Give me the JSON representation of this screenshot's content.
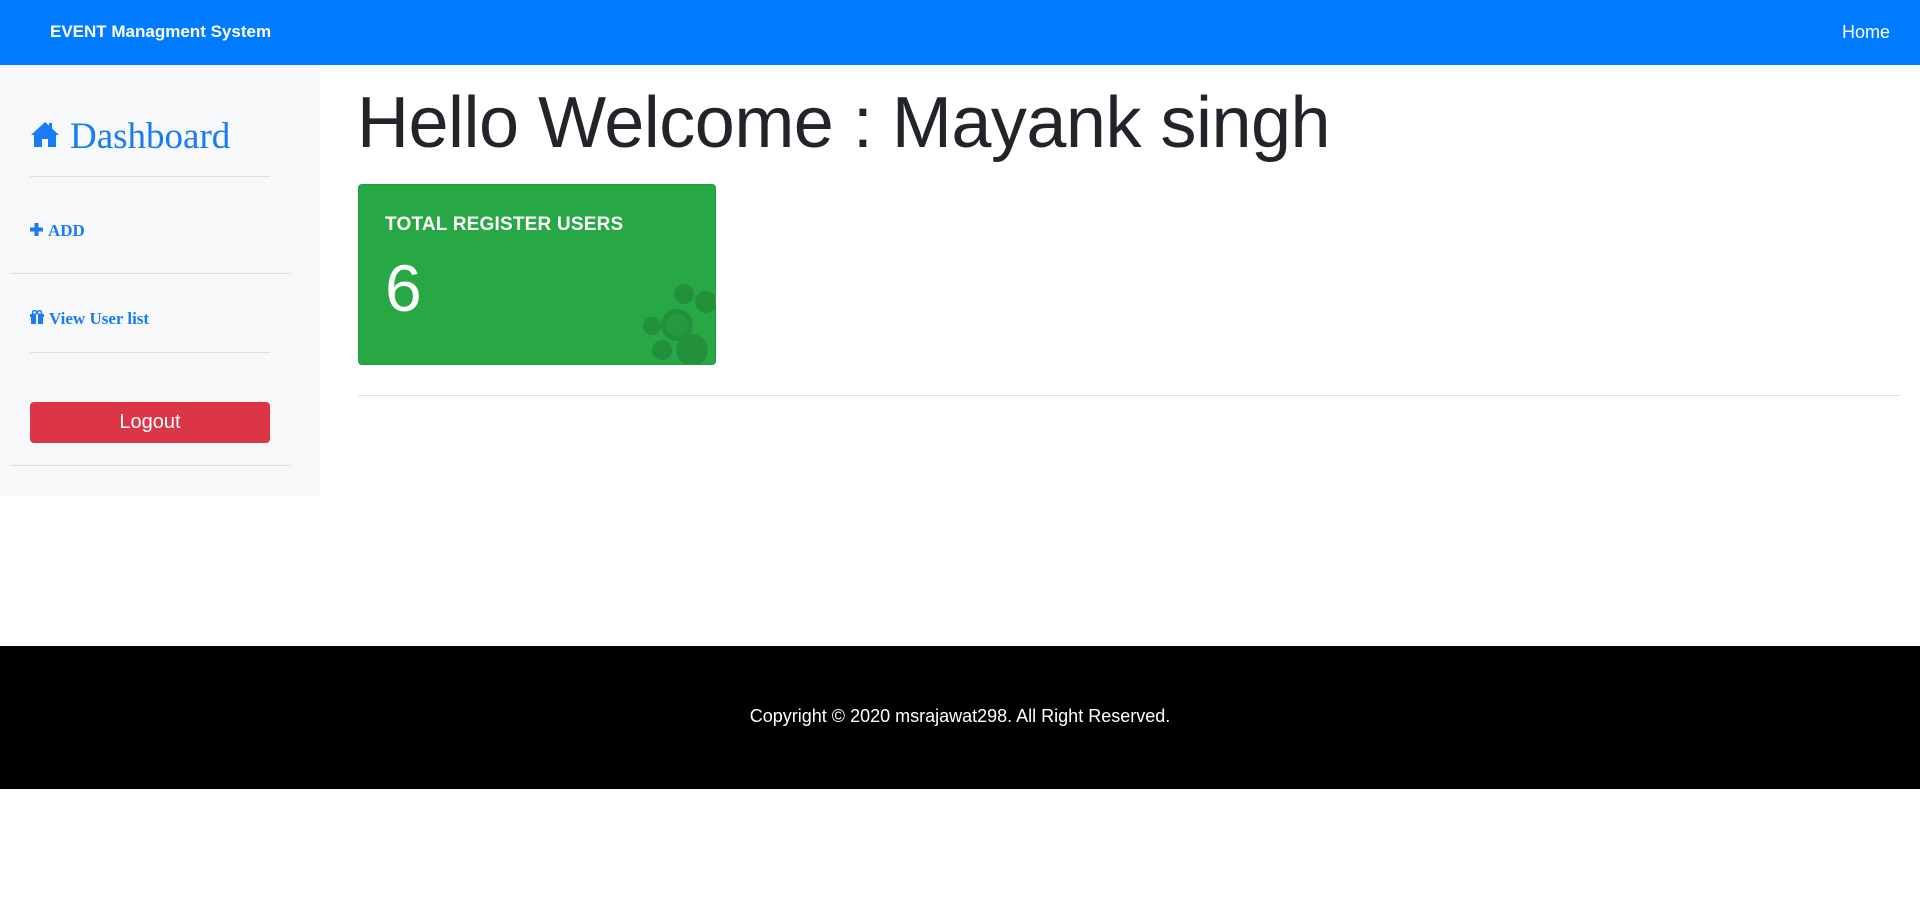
{
  "navbar": {
    "brand": "EVENT Managment System",
    "home_link": "Home",
    "color": "#007bff"
  },
  "sidebar": {
    "dashboard_label": "Dashboard",
    "dashboard_icon": "home-icon",
    "items": [
      {
        "label": "ADD",
        "icon": "plus-icon"
      },
      {
        "label": "View User list",
        "icon": "gift-icon"
      }
    ],
    "logout_label": "Logout",
    "link_color": "#1a7cf5",
    "logout_color": "#dc3545"
  },
  "main": {
    "welcome": "Hello Welcome : Mayank singh",
    "stat_card": {
      "title": "TOTAL REGISTER USERS",
      "value": "6",
      "icon": "paw-icon",
      "color": "#28a745"
    }
  },
  "footer": {
    "copyright": "Copyright © 2020 msrajawat298. All Right Reserved."
  }
}
